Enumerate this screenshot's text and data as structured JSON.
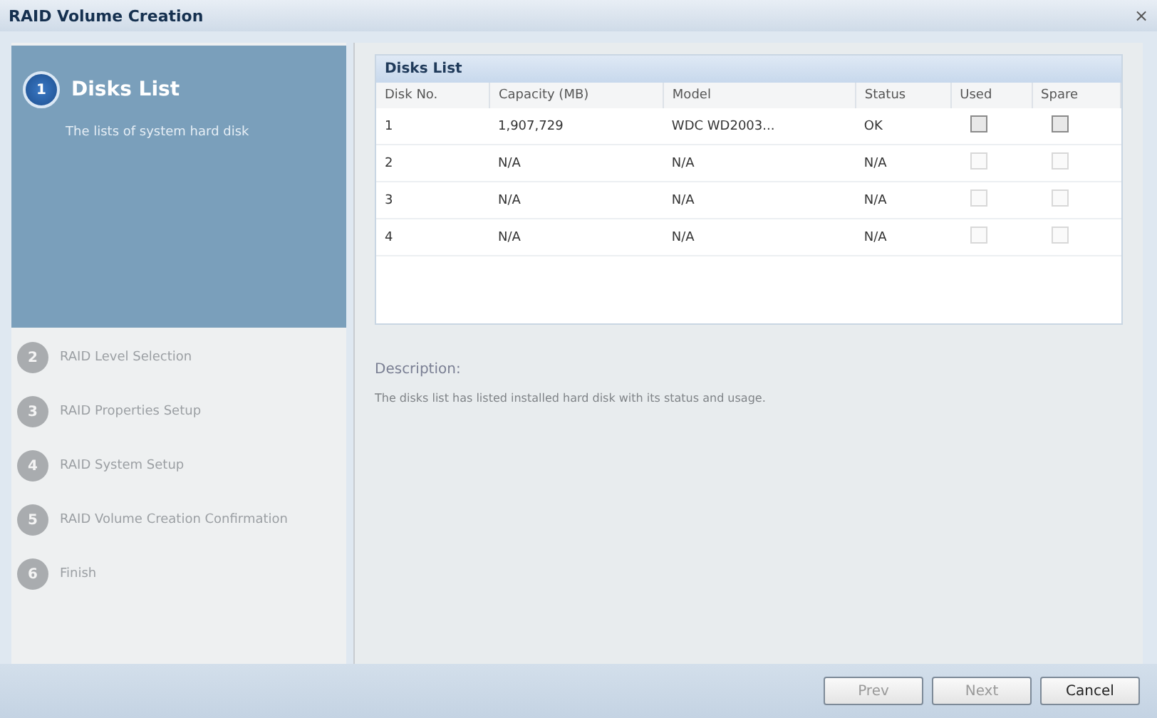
{
  "window": {
    "title": "RAID Volume Creation",
    "close": "×"
  },
  "steps": [
    {
      "number": "1",
      "title": "Disks List",
      "description": "The lists of system hard disk",
      "selected": true
    },
    {
      "number": "2",
      "title": "RAID Level Selection",
      "selected": false
    },
    {
      "number": "3",
      "title": "RAID Properties Setup",
      "selected": false
    },
    {
      "number": "4",
      "title": "RAID System Setup",
      "selected": false
    },
    {
      "number": "5",
      "title": "RAID Volume Creation Confirmation",
      "selected": false
    },
    {
      "number": "6",
      "title": "Finish",
      "selected": false
    }
  ],
  "disks_list": {
    "title": "Disks List",
    "columns": [
      "Disk No.",
      "Capacity (MB)",
      "Model",
      "Status",
      "Used",
      "Spare"
    ],
    "rows": [
      {
        "disk_no": "1",
        "capacity": "1,907,729",
        "model": "WDC WD2003...",
        "status": "OK",
        "used": {
          "checked": false,
          "disabled": false
        },
        "spare": {
          "checked": false,
          "disabled": false
        }
      },
      {
        "disk_no": "2",
        "capacity": "N/A",
        "model": "N/A",
        "status": "N/A",
        "used": {
          "checked": false,
          "disabled": true
        },
        "spare": {
          "checked": false,
          "disabled": true
        }
      },
      {
        "disk_no": "3",
        "capacity": "N/A",
        "model": "N/A",
        "status": "N/A",
        "used": {
          "checked": false,
          "disabled": true
        },
        "spare": {
          "checked": false,
          "disabled": true
        }
      },
      {
        "disk_no": "4",
        "capacity": "N/A",
        "model": "N/A",
        "status": "N/A",
        "used": {
          "checked": false,
          "disabled": true
        },
        "spare": {
          "checked": false,
          "disabled": true
        }
      }
    ]
  },
  "description": {
    "label": "Description:",
    "text": "The disks list has listed installed hard disk with its status and usage."
  },
  "buttons": [
    {
      "label": "Prev",
      "disabled": true
    },
    {
      "label": "Next",
      "disabled": true
    },
    {
      "label": "Cancel",
      "disabled": false
    }
  ]
}
